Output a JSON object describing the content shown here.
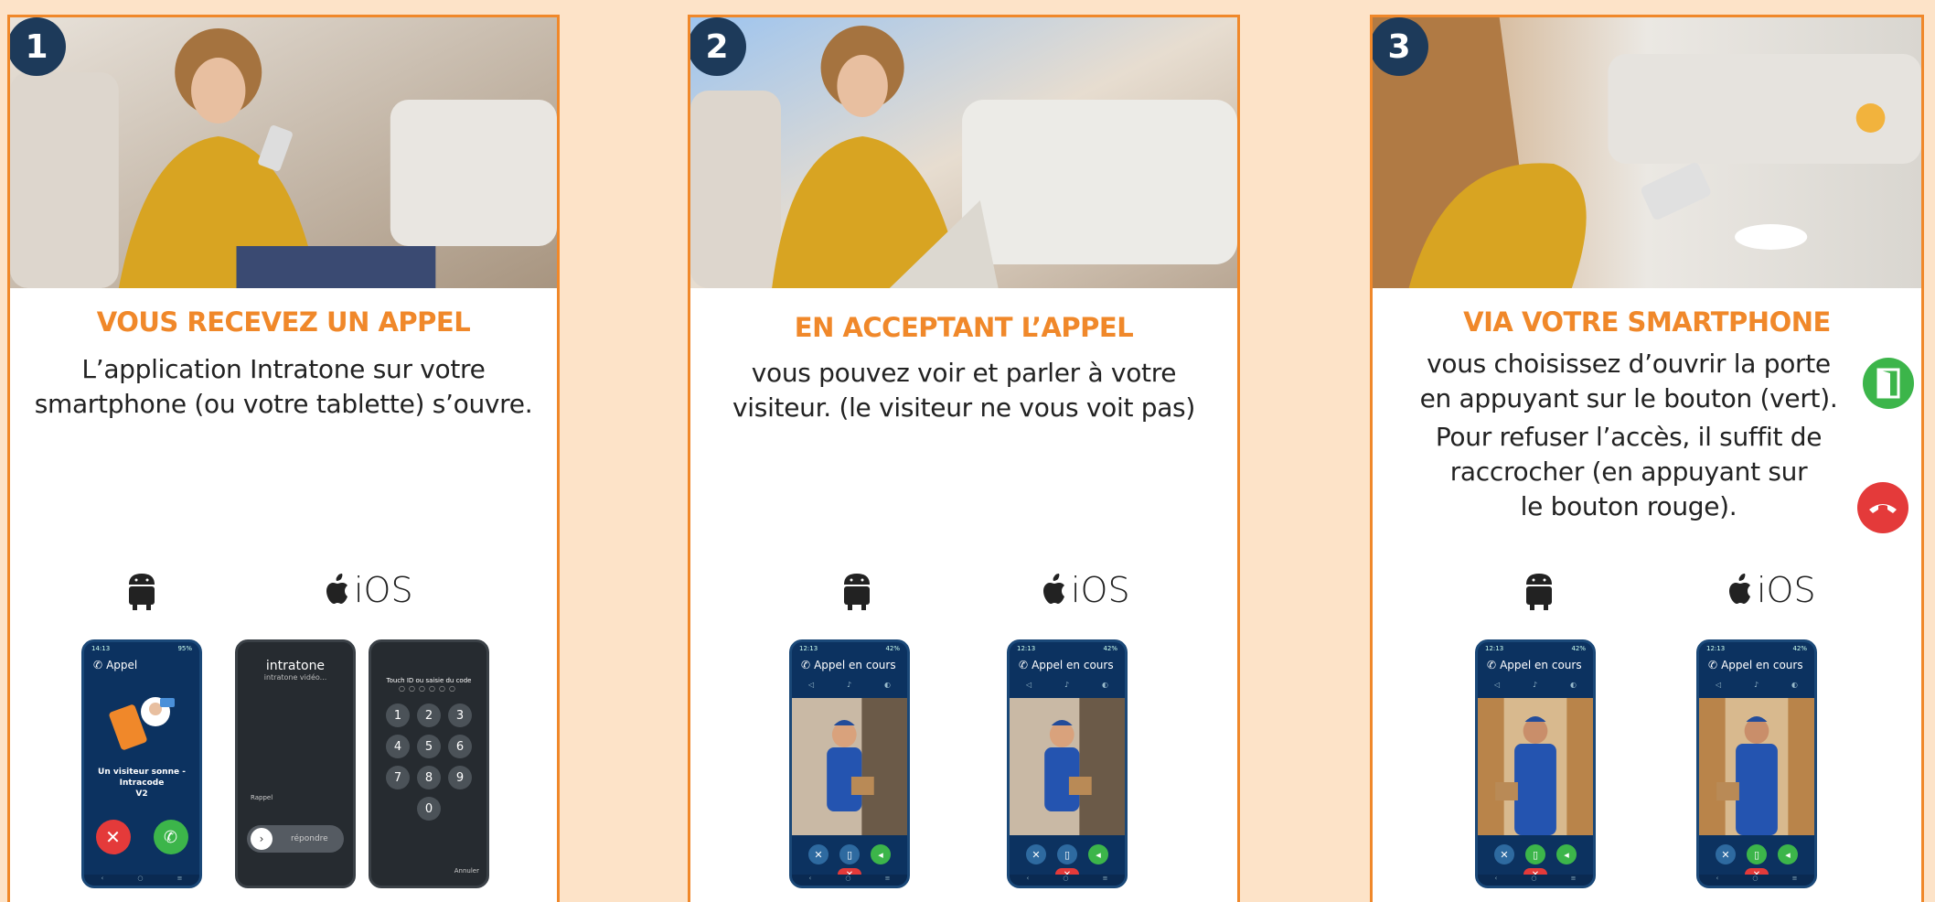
{
  "colors": {
    "accent": "#f0882a",
    "badge": "#1d3a5a",
    "background": "#fde3c8",
    "green": "#3cb54a",
    "red": "#e43a3a"
  },
  "cards": [
    {
      "number": "1",
      "title": "VOUS RECEVEZ UN APPEL",
      "desc_line1": "L’application Intratone sur votre",
      "desc_line2": "smartphone (ou votre tablette) s’ouvre.",
      "ios_label": "iOS",
      "android_screen": {
        "header": "Appel",
        "caption_line1": "Un visiteur sonne - Intracode",
        "caption_line2": "V2"
      },
      "ios_screen_a": {
        "app": "intratone",
        "sub": "intratone vidéo...",
        "slider": "répondre",
        "small": "Rappel"
      },
      "ios_screen_b": {
        "header": "Touch ID ou saisie du code",
        "keys": [
          "1",
          "2",
          "3",
          "4",
          "5",
          "6",
          "7",
          "8",
          "9",
          "0"
        ],
        "cancel": "Annuler"
      }
    },
    {
      "number": "2",
      "title": "EN ACCEPTANT L’APPEL",
      "desc_line1": "vous pouvez voir et parler à votre",
      "desc_line2": "visiteur. (le visiteur ne vous voit pas)",
      "ios_label": "iOS",
      "screen_header": "Appel en cours"
    },
    {
      "number": "3",
      "title": "VIA VOTRE SMARTPHONE",
      "desc_line1": "vous choisissez d’ouvrir la porte",
      "desc_line2": "en appuyant sur le bouton (vert).",
      "desc_line3": "Pour refuser l’accès, il suffit de",
      "desc_line4": "raccrocher (en appuyant sur",
      "desc_line5": "le bouton rouge).",
      "ios_label": "iOS",
      "screen_header": "Appel en cours"
    }
  ]
}
